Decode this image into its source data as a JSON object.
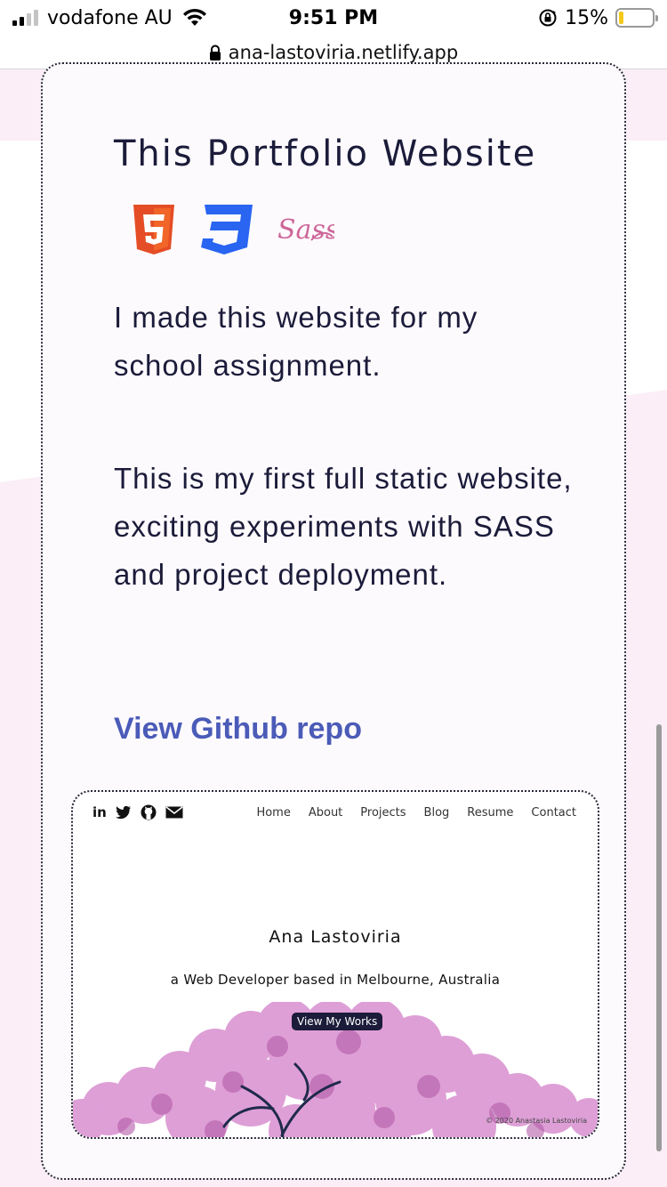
{
  "status_bar": {
    "carrier": "vodafone AU",
    "time": "9:51 PM",
    "battery_percent": "15%",
    "battery_level": 0.15,
    "battery_color": "#f4c91b",
    "icons": [
      "signal-icon",
      "wifi-icon",
      "orientation-lock-icon",
      "battery-icon"
    ]
  },
  "url_bar": {
    "url": "ana-lastoviria.netlify.app",
    "icon": "padlock-icon"
  },
  "card": {
    "title": "This Portfolio Website",
    "tech_icons": [
      "html5-icon",
      "css3-icon",
      "sass-icon"
    ],
    "paragraph_1": "I made this website for my school assignment.",
    "paragraph_2": "This is my first full static website, exciting experiments with SASS and project deployment.",
    "repo_link": "View Github repo",
    "accent_color": "#4b5bb8"
  },
  "preview": {
    "social": [
      "in",
      "twitter-icon",
      "github-icon",
      "mail-icon"
    ],
    "social_linkedin": "in",
    "nav": [
      "Home",
      "About",
      "Projects",
      "Blog",
      "Resume",
      "Contact"
    ],
    "name": "Ana Lastoviria",
    "tagline": "a Web Developer based in Melbourne, Australia",
    "button": "View My Works",
    "copyright": "© 2020 Anastasia Lastoviria"
  }
}
